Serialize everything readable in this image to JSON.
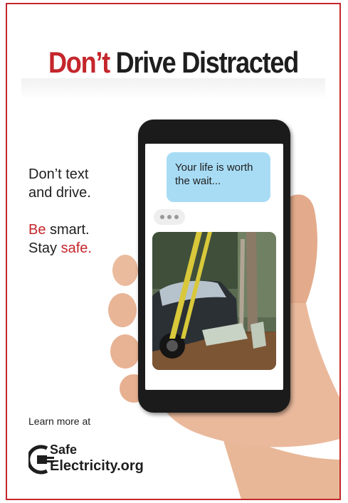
{
  "headline": {
    "part1": "Don’t",
    "part2": "Drive Distracted"
  },
  "body": {
    "line1": "Don’t text",
    "line2": "and drive.",
    "line3_highlight": "Be",
    "line3_rest": " smart.",
    "line4_lead": "Stay ",
    "line4_highlight": "safe."
  },
  "phone": {
    "message": "Your life is worth the wait...",
    "photo_icon": "car-crash-photo"
  },
  "footer": {
    "learn_more": "Learn more at",
    "logo_line1": "Safe",
    "logo_line2": "Electricity.org"
  },
  "colors": {
    "brand_red": "#c4262c",
    "bubble_blue": "#a8dcf5",
    "text_dark": "#1e1e1e"
  }
}
